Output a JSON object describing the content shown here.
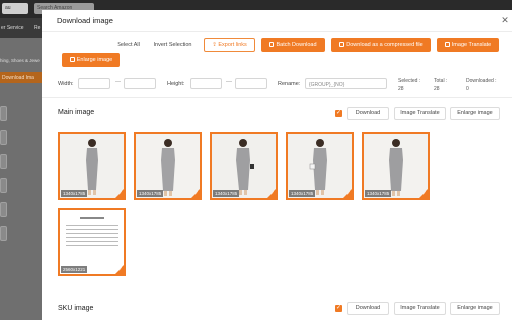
{
  "background": {
    "currency_selector": "au",
    "search_placeholder": "Search Amazon",
    "nav_items": [
      "er Service",
      "Re"
    ],
    "breadcrumb": "hing, Shoes & Jewe",
    "download_button": "Download Ima"
  },
  "modal": {
    "title": "Download image",
    "close_icon": "close-icon",
    "toolbar": {
      "select_all": "Select All",
      "invert_selection": "Invert Selection",
      "export_links": "Export links",
      "batch_download": "Batch Download",
      "download_compressed": "Download as a compressed file",
      "image_translate": "Image Translate",
      "enlarge_image": "Enlarge image"
    },
    "fields": {
      "width_label": "Width:",
      "height_label": "Height:",
      "rename_label": "Rename:",
      "rename_value": "{GROUP}_{NO}",
      "separator": "—"
    },
    "stats": {
      "selected_label": "Selected :",
      "selected_value": "28",
      "total_label": "Total :",
      "total_value": "28",
      "downloaded_label": "Downloaded :",
      "downloaded_value": "0"
    },
    "main_image": {
      "title": "Main image",
      "checked": true,
      "download_label": "Download",
      "translate_label": "Image Translate",
      "enlarge_label": "Enlarge image",
      "thumbnails": [
        {
          "size": "1340x1785",
          "subject": "grey-dress-model"
        },
        {
          "size": "1340x1785",
          "subject": "grey-dress-model"
        },
        {
          "size": "1340x1785",
          "subject": "grey-dress-model"
        },
        {
          "size": "1340x1785",
          "subject": "grey-dress-model"
        },
        {
          "size": "1340x1785",
          "subject": "grey-dress-model"
        },
        {
          "size": "2560x1221",
          "subject": "size-chart"
        }
      ],
      "size_chart_title": "Size Chart"
    },
    "sku_image": {
      "title": "SKU image",
      "checked": true,
      "download_label": "Download",
      "translate_label": "Image Translate",
      "enlarge_label": "Enlarge image"
    }
  },
  "colors": {
    "accent": "#f07a24",
    "overlay": "#7a7a7a"
  }
}
